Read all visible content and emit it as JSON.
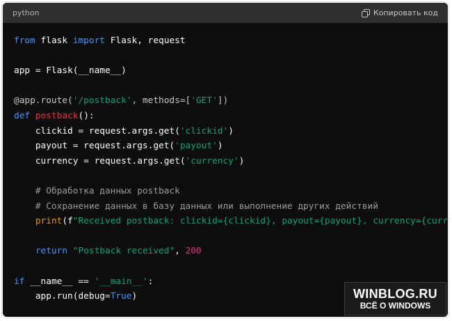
{
  "header": {
    "language": "python",
    "copy_label": "Копировать код",
    "copy_icon": "copy-icon"
  },
  "code": {
    "lines": [
      [
        {
          "t": "kw",
          "v": "from"
        },
        {
          "t": "plain",
          "v": " flask "
        },
        {
          "t": "kw",
          "v": "import"
        },
        {
          "t": "plain",
          "v": " Flask, request"
        }
      ],
      [],
      [
        {
          "t": "plain",
          "v": "app = Flask(__name__)"
        }
      ],
      [],
      [
        {
          "t": "deco",
          "v": "@app.route("
        },
        {
          "t": "str",
          "v": "'/postback'"
        },
        {
          "t": "deco",
          "v": ", methods=["
        },
        {
          "t": "str",
          "v": "'GET'"
        },
        {
          "t": "deco",
          "v": "])"
        }
      ],
      [
        {
          "t": "kw",
          "v": "def"
        },
        {
          "t": "plain",
          "v": " "
        },
        {
          "t": "fn",
          "v": "postback"
        },
        {
          "t": "plain",
          "v": "():"
        }
      ],
      [
        {
          "t": "plain",
          "v": "    clickid = request.args.get("
        },
        {
          "t": "str",
          "v": "'clickid'"
        },
        {
          "t": "plain",
          "v": ")"
        }
      ],
      [
        {
          "t": "plain",
          "v": "    payout = request.args.get("
        },
        {
          "t": "str",
          "v": "'payout'"
        },
        {
          "t": "plain",
          "v": ")"
        }
      ],
      [
        {
          "t": "plain",
          "v": "    currency = request.args.get("
        },
        {
          "t": "str",
          "v": "'currency'"
        },
        {
          "t": "plain",
          "v": ")"
        }
      ],
      [],
      [
        {
          "t": "cm",
          "v": "    # Обработка данных postback"
        }
      ],
      [
        {
          "t": "cm",
          "v": "    # Сохранение данных в базу данных или выполнение других действий"
        }
      ],
      [
        {
          "t": "plain",
          "v": "    "
        },
        {
          "t": "builtin",
          "v": "print"
        },
        {
          "t": "plain",
          "v": "(f"
        },
        {
          "t": "str",
          "v": "\"Received postback: clickid={clickid}, payout={payout}, currency={curren"
        }
      ],
      [],
      [
        {
          "t": "plain",
          "v": "    "
        },
        {
          "t": "kw",
          "v": "return"
        },
        {
          "t": "plain",
          "v": " "
        },
        {
          "t": "str",
          "v": "\"Postback received\""
        },
        {
          "t": "plain",
          "v": ", "
        },
        {
          "t": "num",
          "v": "200"
        }
      ],
      [],
      [
        {
          "t": "kw",
          "v": "if"
        },
        {
          "t": "plain",
          "v": " __name__ == "
        },
        {
          "t": "str",
          "v": "'__main__'"
        },
        {
          "t": "plain",
          "v": ":"
        }
      ],
      [
        {
          "t": "plain",
          "v": "    app.run(debug="
        },
        {
          "t": "kw",
          "v": "True"
        },
        {
          "t": "plain",
          "v": ")"
        }
      ]
    ]
  },
  "watermark": {
    "title": "WINBLOG.RU",
    "subtitle": "ВСЁ О WINDOWS"
  },
  "colors": {
    "keyword": "#3f95ff",
    "string": "#00a67d",
    "number": "#df3079",
    "function": "#f22c3d",
    "builtin": "#e9950c",
    "comment": "#9b9b9b",
    "background": "#0d0d0d",
    "header_bg": "#2f2f2f"
  }
}
